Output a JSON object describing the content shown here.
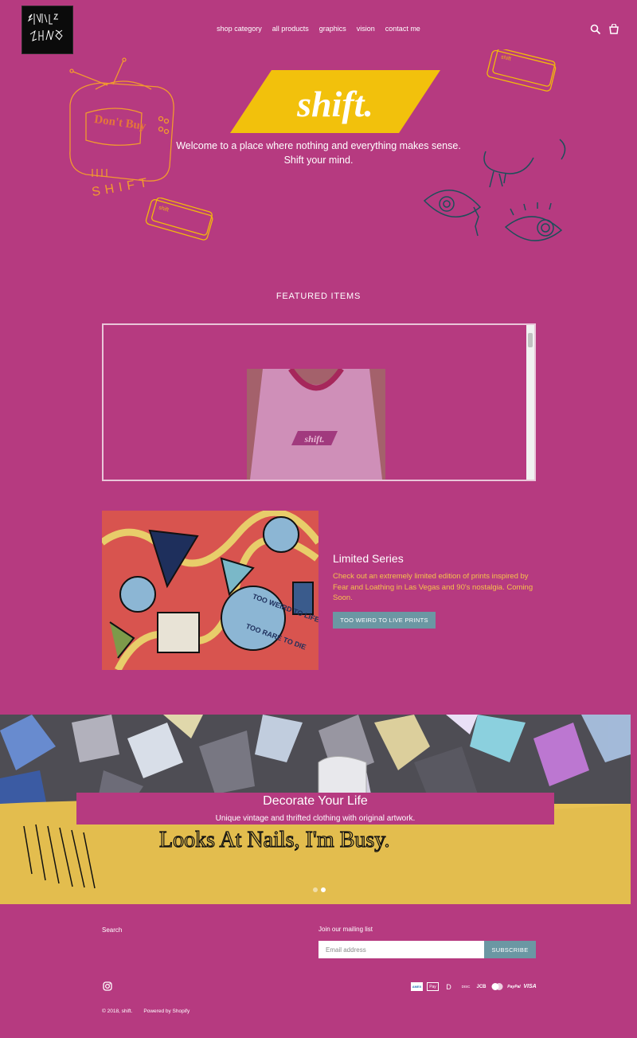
{
  "header": {
    "logo_alt": "SENSIBLE CHAOS",
    "nav": [
      "shop category",
      "all products",
      "graphics",
      "vision",
      "contact me"
    ],
    "icons": [
      "search-icon",
      "cart-icon"
    ]
  },
  "hero": {
    "brand": "shift.",
    "tagline_1": "Welcome to a place where nothing and everything makes sense.",
    "tagline_2": "Shift your mind.",
    "doodle_tv_text": "Don't Buy",
    "doodle_tv_caption": "SHIFT",
    "doodle_key_text": "shift"
  },
  "featured": {
    "title": "FEATURED ITEMS",
    "product_print": "shift."
  },
  "limited": {
    "title": "Limited Series",
    "text": "Check out an extremely limited edition of prints inspired by Fear and Loathing in Las Vegas and 90's nostalgia. Coming Soon.",
    "button": "TOO WEIRD TO LIVE PRINTS",
    "art_text_1": "TOO WEIRD TO LIFE",
    "art_text_2": "TOO RARE TO DIE"
  },
  "slideshow": {
    "title": "Decorate Your Life",
    "subtitle": "Unique vintage and thrifted clothing with original artwork.",
    "shirt_print": "Looks At Nails, I'm Busy."
  },
  "footer": {
    "search": "Search",
    "mailing_title": "Join our mailing list",
    "email_placeholder": "Email address",
    "subscribe": "SUBSCRIBE",
    "copyright": "© 2018, shift.",
    "powered": "Powered by Shopify",
    "payments": [
      "AMEX",
      "Pay",
      "D",
      "DISC",
      "JCB",
      "MC",
      "PayPal",
      "VISA"
    ]
  },
  "colors": {
    "background": "#b63a80",
    "accent_yellow": "#f2c10c",
    "button": "#6b97a3",
    "text_yellow": "#f6c24b"
  }
}
